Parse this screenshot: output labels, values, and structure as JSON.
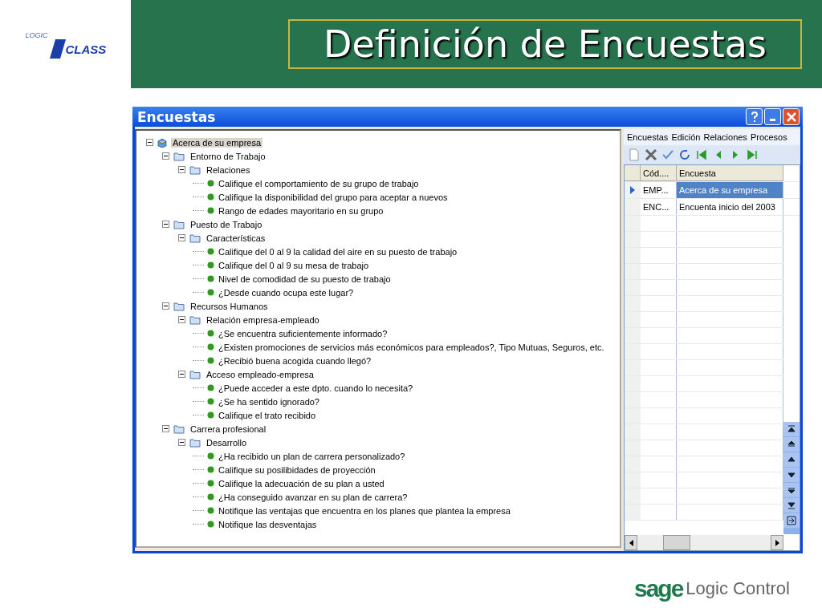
{
  "logo": {
    "top": "LOGIC",
    "main": "CLASS"
  },
  "slide_title": "Definición de Encuestas",
  "window": {
    "title": "Encuestas"
  },
  "tree": [
    {
      "kind": "root",
      "label": "Acerca de su empresa",
      "selected": true,
      "expanded": true,
      "children": [
        {
          "kind": "folder",
          "label": "Entorno de Trabajo",
          "selected": false,
          "expanded": true,
          "children": [
            {
              "kind": "folder",
              "label": "Relaciones",
              "selected": false,
              "expanded": true,
              "children": [
                {
                  "kind": "question",
                  "label": "Califique el comportamiento de su grupo de trabajo",
                  "selected": false
                },
                {
                  "kind": "question",
                  "label": "Califique la disponibilidad del grupo para aceptar a nuevos",
                  "selected": false
                },
                {
                  "kind": "question",
                  "label": "Rango de edades mayoritario en su grupo",
                  "selected": false
                }
              ]
            }
          ]
        },
        {
          "kind": "folder",
          "label": "Puesto de Trabajo",
          "selected": false,
          "expanded": true,
          "children": [
            {
              "kind": "folder",
              "label": "Características",
              "selected": false,
              "expanded": true,
              "children": [
                {
                  "kind": "question",
                  "label": "Califique del 0 al 9 la calidad del aire en su puesto de trabajo",
                  "selected": false
                },
                {
                  "kind": "question",
                  "label": "Califique del 0 al 9 su mesa de trabajo",
                  "selected": false
                },
                {
                  "kind": "question",
                  "label": "Nivel de comodidad de su puesto de trabajo",
                  "selected": false
                },
                {
                  "kind": "question",
                  "label": "¿Desde cuando ocupa este lugar?",
                  "selected": false
                }
              ]
            }
          ]
        },
        {
          "kind": "folder",
          "label": "Recursos Humanos",
          "selected": false,
          "expanded": true,
          "children": [
            {
              "kind": "folder",
              "label": "Relación empresa-empleado",
              "selected": false,
              "expanded": true,
              "children": [
                {
                  "kind": "question",
                  "label": "¿Se encuentra suficientemente informado?",
                  "selected": false
                },
                {
                  "kind": "question",
                  "label": "¿Existen promociones de servicios más económicos para empleados?, Tipo Mutuas, Seguros, etc.",
                  "selected": false
                },
                {
                  "kind": "question",
                  "label": "¿Recibió buena acogida cuando llegó?",
                  "selected": false
                }
              ]
            },
            {
              "kind": "folder",
              "label": "Acceso empleado-empresa",
              "selected": false,
              "expanded": true,
              "children": [
                {
                  "kind": "question",
                  "label": "¿Puede acceder a este dpto. cuando lo necesita?",
                  "selected": false
                },
                {
                  "kind": "question",
                  "label": "¿Se ha sentido ignorado?",
                  "selected": false
                },
                {
                  "kind": "question",
                  "label": "Califique el trato recibido",
                  "selected": false
                }
              ]
            }
          ]
        },
        {
          "kind": "folder",
          "label": "Carrera profesional",
          "selected": false,
          "expanded": true,
          "children": [
            {
              "kind": "folder",
              "label": "Desarrollo",
              "selected": false,
              "expanded": true,
              "children": [
                {
                  "kind": "question",
                  "label": "¿Ha recibido un plan de carrera personalizado?",
                  "selected": false
                },
                {
                  "kind": "question",
                  "label": "Califique su posilibidades de proyección",
                  "selected": false
                },
                {
                  "kind": "question",
                  "label": "Califique la adecuación de su plan a usted",
                  "selected": false
                },
                {
                  "kind": "question",
                  "label": "¿Ha conseguido avanzar en su plan de carrera?",
                  "selected": false
                },
                {
                  "kind": "question",
                  "label": "Notifique las ventajas que encuentra en los planes que plantea la empresa",
                  "selected": false
                },
                {
                  "kind": "question",
                  "label": "Notifique las desventajas",
                  "selected": false
                }
              ]
            }
          ]
        }
      ]
    }
  ],
  "menu": [
    "Encuestas",
    "Edición",
    "Relaciones",
    "Procesos"
  ],
  "table": {
    "columns": [
      "Cód....",
      "Encuesta"
    ],
    "rows": [
      {
        "code": "EMP...",
        "name": "Acerca de su empresa",
        "selected": true
      },
      {
        "code": "ENC...",
        "name": "Encuenta inicio del 2003",
        "selected": false
      }
    ]
  },
  "brand": {
    "mark": "sage",
    "name": "Logic Control"
  }
}
